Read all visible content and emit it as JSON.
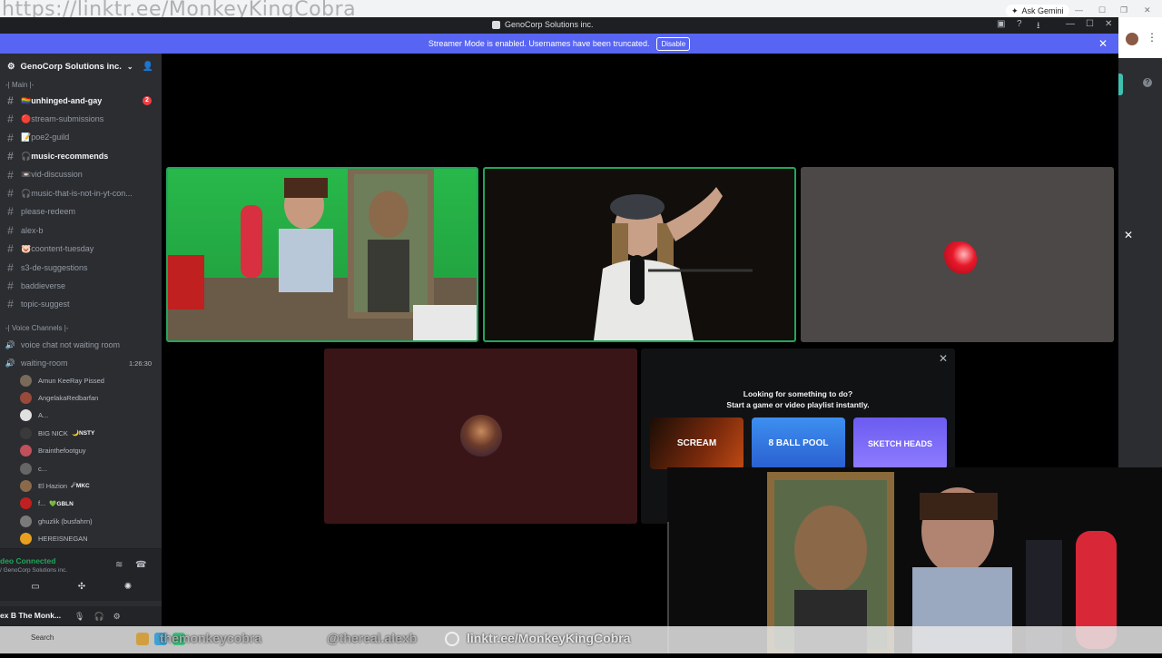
{
  "browser": {
    "overlay_url": "https://linktr.ee/MonkeyKingCobra",
    "ask_gemini": "Ask Gemini"
  },
  "window": {
    "title": "GenoCorp Solutions inc."
  },
  "streamer_bar": {
    "message": "Streamer Mode is enabled. Usernames have been truncated.",
    "disable_label": "Disable"
  },
  "server": {
    "name": "GenoCorp Solutions inc.",
    "main_category": "-| Main |-",
    "voice_category": "-| Voice Channels |-",
    "channels": [
      {
        "label": "🏳️‍🌈unhinged-and-gay",
        "unread": true,
        "badge": "2"
      },
      {
        "label": "🔴stream-submissions",
        "unread": false
      },
      {
        "label": "📝poe2-guild",
        "unread": false
      },
      {
        "label": "🎧music-recommends",
        "unread": true
      },
      {
        "label": "📼vid-discussion",
        "unread": false
      },
      {
        "label": "🎧music-that-is-not-in-yt-con...",
        "unread": false
      },
      {
        "label": "please-redeem",
        "unread": false
      },
      {
        "label": "alex-b",
        "unread": false
      },
      {
        "label": "🐷coontent-tuesday",
        "unread": false
      },
      {
        "label": "s3-de-suggestions",
        "unread": false
      },
      {
        "label": "baddieverse",
        "unread": false
      },
      {
        "label": "topic-suggest",
        "unread": false
      }
    ],
    "voice_channels": [
      {
        "label": "voice chat not waiting room"
      },
      {
        "label": "waiting-room",
        "timer": "1:26:30"
      }
    ],
    "voice_users": [
      {
        "name": "Amun KeeRay Pissed",
        "color": "#7a6a5a"
      },
      {
        "name": "AngelakaRedbarfan",
        "tag": "",
        "color": "#9a4a3a"
      },
      {
        "name": "A...",
        "color": "#e0e0e0"
      },
      {
        "name": "BIG NICK",
        "tag": "🌙NSTY",
        "color": "#3a3a3a"
      },
      {
        "name": "Brainthefootguy",
        "color": "#c0505a"
      },
      {
        "name": "c...",
        "color": "#666"
      },
      {
        "name": "El Hazion",
        "tag": "☄MKC",
        "color": "#8a6a4a"
      },
      {
        "name": "f...",
        "tag": "💚GBLN",
        "color": "#c02020"
      },
      {
        "name": "ghuzlik (busfahrn)",
        "color": "#7a7a7a"
      },
      {
        "name": "HEREISNEGAN",
        "color": "#e8a020"
      }
    ]
  },
  "voice_panel": {
    "status": "deo Connected",
    "sub": "/ GenoCorp Solutions inc."
  },
  "user_panel": {
    "name": "ex B The Monk..."
  },
  "activity": {
    "line1": "Looking for something to do?",
    "line2": "Start a game or video playlist instantly.",
    "games": [
      "SCREAM",
      "8 BALL POOL",
      "SKETCH HEADS"
    ]
  },
  "taskbar": {
    "search": "Search"
  },
  "overlay_handles": {
    "a": "themonkeycobra",
    "b": "@thereal.alexb",
    "main": "linktr.ee/MonkeyKingCobra"
  }
}
